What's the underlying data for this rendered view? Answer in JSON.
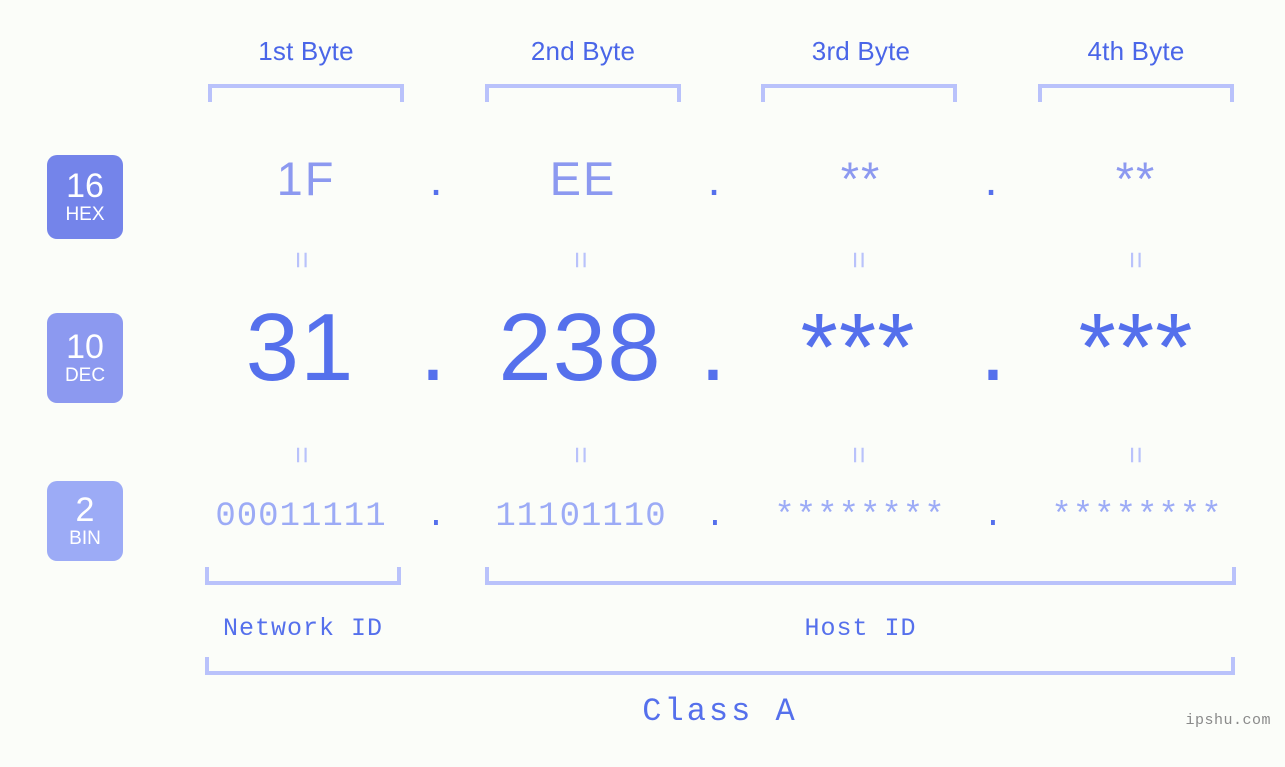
{
  "background_color": "#fbfdf9",
  "accent_colors": {
    "strong_blue": "#5570ec",
    "mid_blue": "#8c99f0",
    "light_blue": "#9cabf6",
    "pale_blue": "#b9c2fb",
    "header_blue": "#4a66e8",
    "badge_hex": "#7484ea",
    "badge_dec": "#8c99f0",
    "badge_bin": "#9cabf6",
    "watermark_gray": "#8a8a8a"
  },
  "headers": {
    "bytes": [
      {
        "label": "1st Byte"
      },
      {
        "label": "2nd Byte"
      },
      {
        "label": "3rd Byte"
      },
      {
        "label": "4th Byte"
      }
    ]
  },
  "bases": [
    {
      "number": "16",
      "name": "HEX"
    },
    {
      "number": "10",
      "name": "DEC"
    },
    {
      "number": "2",
      "name": "BIN"
    }
  ],
  "rows": {
    "hex": {
      "base_number": "16",
      "base_name": "HEX",
      "values": [
        "1F",
        "EE",
        "**",
        "**"
      ],
      "separator": "."
    },
    "dec": {
      "base_number": "10",
      "base_name": "DEC",
      "values": [
        "31",
        "238",
        "***",
        "***"
      ],
      "separator": "."
    },
    "bin": {
      "base_number": "2",
      "base_name": "BIN",
      "values": [
        "00011111",
        "11101110",
        "********",
        "********"
      ],
      "separator": "."
    }
  },
  "equality_connector": "=",
  "segments": {
    "network_id": {
      "label": "Network ID"
    },
    "host_id": {
      "label": "Host ID"
    }
  },
  "class": {
    "label": "Class A"
  },
  "watermark": {
    "text": "ipshu.com"
  }
}
